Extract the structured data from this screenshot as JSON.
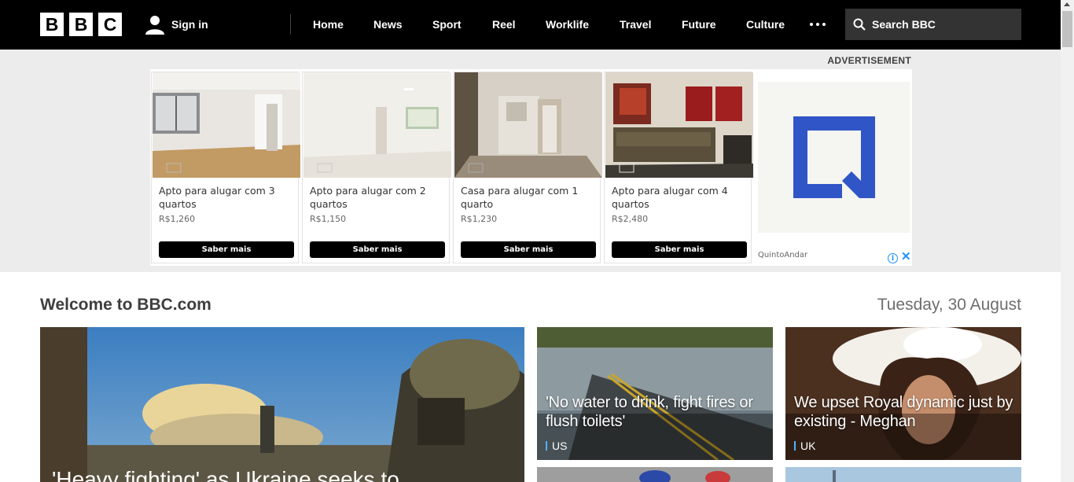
{
  "header": {
    "logo_letters": [
      "B",
      "B",
      "C"
    ],
    "signin_label": "Sign in",
    "nav": [
      "Home",
      "News",
      "Sport",
      "Reel",
      "Worklife",
      "Travel",
      "Future",
      "Culture"
    ],
    "search_placeholder": "Search BBC"
  },
  "advert": {
    "label": "ADVERTISEMENT",
    "cards": [
      {
        "title": "Apto para alugar com 3 quartos",
        "price": "R$1,260",
        "button": "Saber mais"
      },
      {
        "title": "Apto para alugar com 2 quartos",
        "price": "R$1,150",
        "button": "Saber mais"
      },
      {
        "title": "Casa para alugar com 1 quarto",
        "price": "R$1,230",
        "button": "Saber mais"
      },
      {
        "title": "Apto para alugar com 4 quartos",
        "price": "R$2,480",
        "button": "Saber mais"
      }
    ],
    "brand_name": "QuintoAndar",
    "brand_color": "#3055c6",
    "info_symbol": "i",
    "close_symbol": "✕"
  },
  "welcome": {
    "title": "Welcome to BBC.com",
    "date": "Tuesday, 30 August"
  },
  "stories": [
    {
      "headline": "'Heavy fighting' as Ukraine seeks to",
      "tag": ""
    },
    {
      "headline": "'No water to drink, fight fires or flush toilets'",
      "tag": "US"
    },
    {
      "headline": "We upset Royal dynamic just by existing - Meghan",
      "tag": "UK"
    }
  ],
  "colors": {
    "topbar": "#000000",
    "tag_accent": "#4fb4ff"
  }
}
